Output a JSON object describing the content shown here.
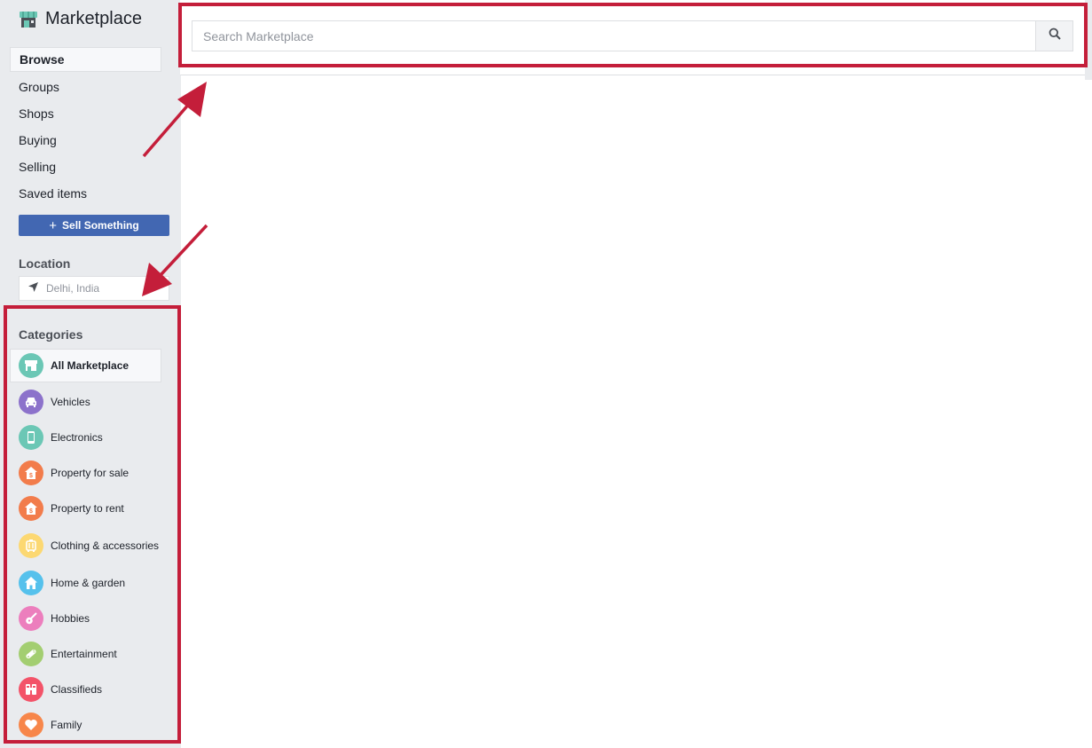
{
  "app": {
    "title": "Marketplace",
    "icon": "storefront-icon"
  },
  "sidebar": {
    "nav_items": [
      {
        "label": "Browse",
        "active": true
      },
      {
        "label": "Groups",
        "active": false
      },
      {
        "label": "Shops",
        "active": false
      },
      {
        "label": "Buying",
        "active": false
      },
      {
        "label": "Selling",
        "active": false
      },
      {
        "label": "Saved items",
        "active": false
      }
    ],
    "sell_button": {
      "icon": "plus-icon",
      "label": "Sell Something"
    },
    "location": {
      "label": "Location",
      "icon": "location-arrow-icon",
      "value": "Delhi, India"
    },
    "categories": {
      "label": "Categories",
      "items": [
        {
          "label": "All Marketplace",
          "icon": "storefront-icon",
          "color": "#6bc7b5",
          "active": true
        },
        {
          "label": "Vehicles",
          "icon": "car-icon",
          "color": "#8c72cb"
        },
        {
          "label": "Electronics",
          "icon": "phone-icon",
          "color": "#6bc7b5"
        },
        {
          "label": "Property for sale",
          "icon": "house-dollar-icon",
          "color": "#f27c4b"
        },
        {
          "label": "Property to rent",
          "icon": "house-dollar-icon",
          "color": "#f27c4b"
        },
        {
          "label": "Clothing & accessories",
          "icon": "luggage-icon",
          "color": "#fcd872"
        },
        {
          "label": "Home & garden",
          "icon": "home-icon",
          "color": "#55c1ec"
        },
        {
          "label": "Hobbies",
          "icon": "guitar-icon",
          "color": "#ec7ebd"
        },
        {
          "label": "Entertainment",
          "icon": "gamepad-icon",
          "color": "#a3ce71"
        },
        {
          "label": "Classifieds",
          "icon": "binoculars-icon",
          "color": "#f35369"
        },
        {
          "label": "Family",
          "icon": "heart-icon",
          "color": "#f7864a"
        }
      ]
    }
  },
  "search": {
    "placeholder": "Search Marketplace",
    "value": "",
    "button_icon": "search-icon"
  },
  "annotations": {
    "highlight_color": "#c41e3a"
  }
}
